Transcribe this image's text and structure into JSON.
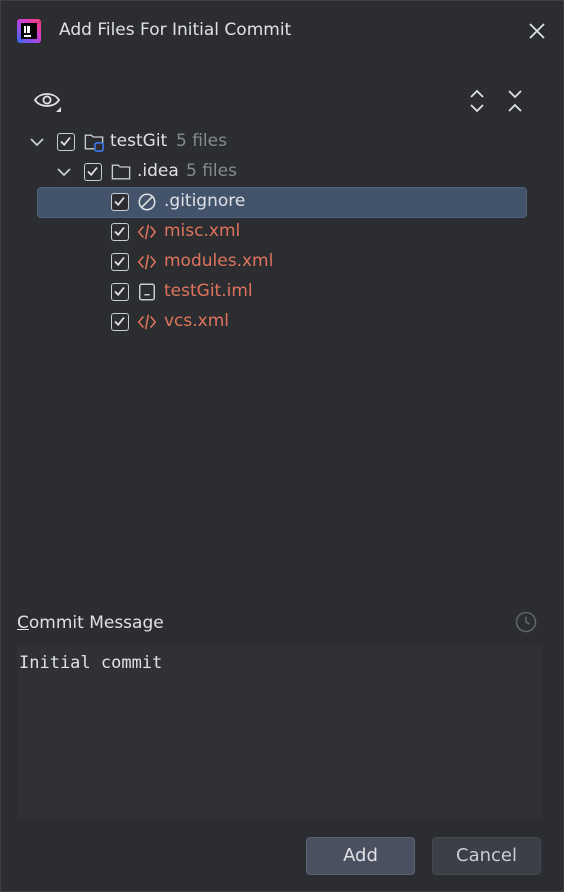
{
  "window": {
    "title": "Add Files For Initial Commit"
  },
  "icons": {
    "app": "intellij-logo-icon",
    "close": "close-icon",
    "eye": "eye-icon",
    "expand": "expand-all-icon",
    "collapse": "collapse-all-icon",
    "history": "history-clock-icon"
  },
  "colors": {
    "background": "#2b2d30",
    "selection": "#43536c",
    "new_file_text": "#e0735e",
    "muted_text": "#868a91"
  },
  "tree": {
    "root": {
      "label": "testGit",
      "count": "5 files",
      "checked": true,
      "expanded": true
    },
    "folder": {
      "label": ".idea",
      "count": "5 files",
      "checked": true,
      "expanded": true
    },
    "files": [
      {
        "label": ".gitignore",
        "icon": "ignored-file-icon",
        "checked": true,
        "selected": true
      },
      {
        "label": "misc.xml",
        "icon": "xml-file-icon",
        "checked": true
      },
      {
        "label": "modules.xml",
        "icon": "xml-file-icon",
        "checked": true
      },
      {
        "label": "testGit.iml",
        "icon": "module-file-icon",
        "checked": true
      },
      {
        "label": "vcs.xml",
        "icon": "xml-file-icon",
        "checked": true
      }
    ]
  },
  "commit": {
    "label_first": "C",
    "label_rest": "ommit Message",
    "message": "Initial commit"
  },
  "buttons": {
    "add": "Add",
    "cancel": "Cancel"
  }
}
